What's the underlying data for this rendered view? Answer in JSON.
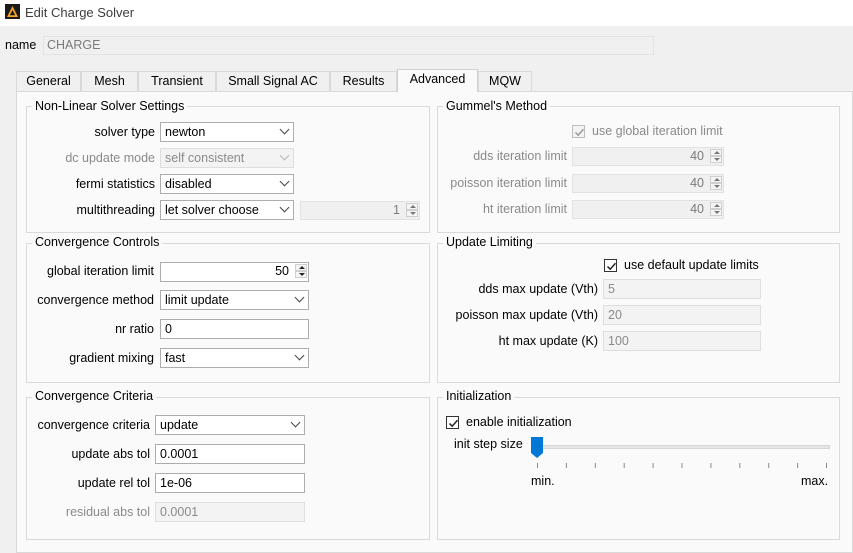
{
  "window": {
    "title": "Edit Charge Solver"
  },
  "name_row": {
    "label": "name",
    "value": "CHARGE"
  },
  "tabs": [
    "General",
    "Mesh",
    "Transient",
    "Small Signal AC",
    "Results",
    "Advanced",
    "MQW"
  ],
  "active_tab": "Advanced",
  "nonlinear": {
    "title": "Non-Linear Solver Settings",
    "solver_type": {
      "label": "solver type",
      "value": "newton"
    },
    "dc_update_mode": {
      "label": "dc update mode",
      "value": "self consistent"
    },
    "fermi_statistics": {
      "label": "fermi statistics",
      "value": "disabled"
    },
    "multithreading": {
      "label": "multithreading",
      "value": "let solver choose",
      "threads": "1"
    }
  },
  "gummel": {
    "title": "Gummel's Method",
    "use_global_label": "use global iteration limit",
    "dds_label": "dds iteration limit",
    "dds_value": "40",
    "poisson_label": "poisson iteration limit",
    "poisson_value": "40",
    "ht_label": "ht iteration limit",
    "ht_value": "40"
  },
  "convergence_controls": {
    "title": "Convergence Controls",
    "global_iteration_label": "global iteration limit",
    "global_iteration_value": "50",
    "method_label": "convergence method",
    "method_value": "limit update",
    "nr_ratio_label": "nr ratio",
    "nr_ratio_value": "0",
    "gradient_label": "gradient mixing",
    "gradient_value": "fast"
  },
  "update_limiting": {
    "title": "Update Limiting",
    "use_default_label": "use default update limits",
    "dds_label": "dds max update (Vth)",
    "dds_value": "5",
    "poisson_label": "poisson  max update (Vth)",
    "poisson_value": "20",
    "ht_label": "ht max update (K)",
    "ht_value": "100"
  },
  "convergence_criteria": {
    "title": "Convergence Criteria",
    "criteria_label": "convergence criteria",
    "criteria_value": "update",
    "abs_tol_label": "update abs tol",
    "abs_tol_value": "0.0001",
    "rel_tol_label": "update rel tol",
    "rel_tol_value": "1e-06",
    "residual_label": "residual abs tol",
    "residual_value": "0.0001"
  },
  "initialization": {
    "title": "Initialization",
    "enable_label": "enable initialization",
    "step_label": "init step size",
    "min_label": "min.",
    "max_label": "max.",
    "slider_level": 0
  },
  "colors": {
    "accent": "#0078d7",
    "panel": "#fafafa",
    "window": "#f0f0f0"
  }
}
